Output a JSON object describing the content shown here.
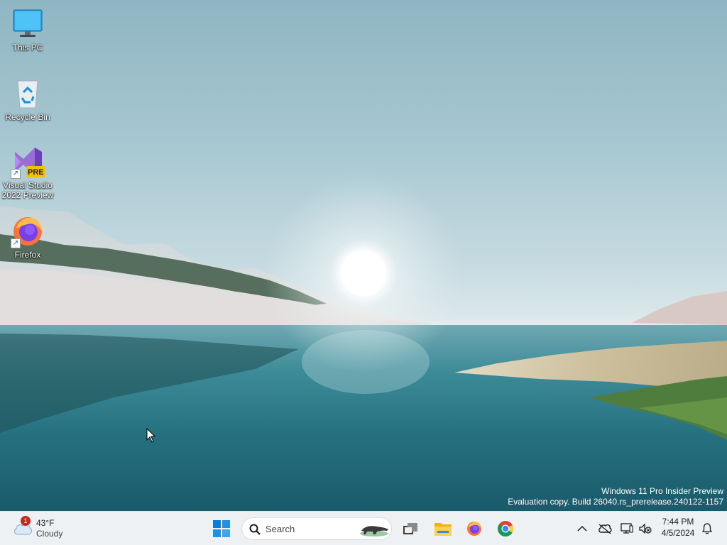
{
  "desktop": {
    "icons": [
      {
        "label": "This PC",
        "icon": "monitor-icon"
      },
      {
        "label": "Recycle Bin",
        "icon": "recycle-bin-icon"
      },
      {
        "label_line1": "Visual Studio",
        "label_line2": "2022 Preview",
        "badge": "PRE",
        "icon": "visual-studio-icon"
      },
      {
        "label": "Firefox",
        "icon": "firefox-icon"
      }
    ]
  },
  "watermark": {
    "line1": "Windows 11 Pro Insider Preview",
    "line2": "Evaluation copy. Build 26040.rs_prerelease.240122-1157"
  },
  "taskbar": {
    "weather": {
      "temperature": "43°F",
      "condition": "Cloudy",
      "badge_count": "1"
    },
    "search": {
      "label": "Search"
    },
    "apps": [
      "windows-start-icon",
      "task-view-icon",
      "file-explorer-icon",
      "firefox-icon",
      "chrome-icon"
    ],
    "clock": {
      "time": "7:44 PM",
      "date": "4/5/2024"
    }
  },
  "colors": {
    "taskbar_bg": "#eef1f4",
    "accent_blue": "#0078d4",
    "badge_red": "#c42b1c"
  }
}
